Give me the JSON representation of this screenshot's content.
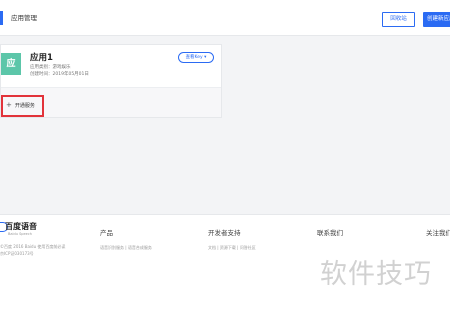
{
  "header": {
    "title": "应用管理",
    "recycle_label": "回收站",
    "create_label": "创建新应用"
  },
  "app_card": {
    "icon_char": "应",
    "name": "应用1",
    "category": "应用类别：游戏娱乐",
    "created": "创建时间：2019年05月01日",
    "api_key_label": "查看Key ▾",
    "open_service": {
      "plus": "+",
      "label": "开通服务"
    }
  },
  "footer": {
    "logo_text": "百度语音",
    "logo_sub": "Baidu Speech",
    "copyright_line1": "©百度 2016 Baidu 使用百度前必读",
    "copyright_line2": "京ICP证030173号",
    "columns": [
      {
        "title": "产品",
        "links": "语音识别服务  |  语音合成服务"
      },
      {
        "title": "开发者支持",
        "links": "文档  |  资源下载  |  问答社区"
      },
      {
        "title": "联系我们",
        "links": ""
      },
      {
        "title": "关注我们",
        "links": ""
      }
    ]
  },
  "watermark": "软件技巧",
  "colors": {
    "primary": "#2b6bf3",
    "app_icon": "#5cc6a9",
    "highlight": "#e2333a",
    "page_bg": "#f3f4f6"
  }
}
